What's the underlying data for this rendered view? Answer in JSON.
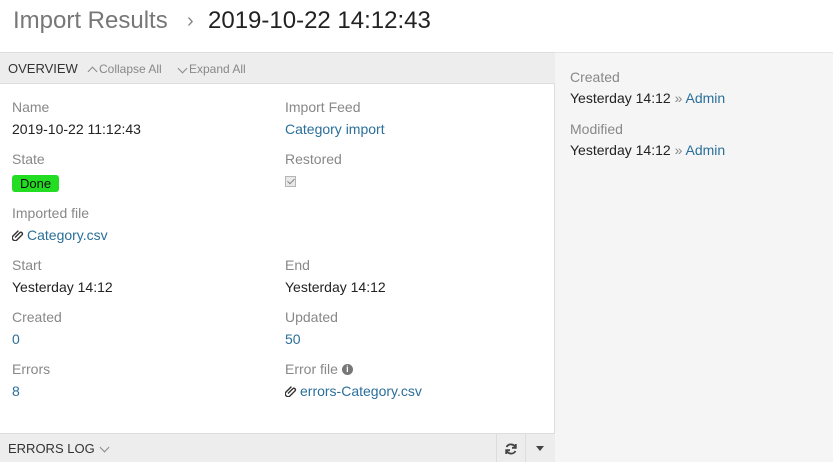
{
  "header": {
    "breadcrumb": "Import Results",
    "separator": "›",
    "title": "2019-10-22 14:12:43"
  },
  "overview": {
    "title": "OVERVIEW",
    "collapse_all": "Collapse All",
    "expand_all": "Expand All",
    "fields": {
      "name": {
        "label": "Name",
        "value": "2019-10-22 11:12:43"
      },
      "import_feed": {
        "label": "Import Feed",
        "value": "Category import"
      },
      "state": {
        "label": "State",
        "value": "Done",
        "color": "#22dd22"
      },
      "restored": {
        "label": "Restored",
        "checked": true
      },
      "imported_file": {
        "label": "Imported file",
        "value": "Category.csv"
      },
      "start": {
        "label": "Start",
        "value": "Yesterday 14:12"
      },
      "end": {
        "label": "End",
        "value": "Yesterday 14:12"
      },
      "created": {
        "label": "Created",
        "value": "0"
      },
      "updated": {
        "label": "Updated",
        "value": "50"
      },
      "errors": {
        "label": "Errors",
        "value": "8"
      },
      "error_file": {
        "label": "Error file",
        "value": "errors-Category.csv"
      }
    }
  },
  "errors_log": {
    "title": "ERRORS LOG"
  },
  "sidebar": {
    "created_label": "Created",
    "created_time": "Yesterday 14:12",
    "created_sep": "»",
    "created_by": "Admin",
    "modified_label": "Modified",
    "modified_time": "Yesterday 14:12",
    "modified_sep": "»",
    "modified_by": "Admin"
  },
  "colors": {
    "link": "#2a6f9b",
    "badge_done": "#22dd22",
    "panel_header": "#ededed",
    "sidebar_bg": "#f5f5f5"
  }
}
